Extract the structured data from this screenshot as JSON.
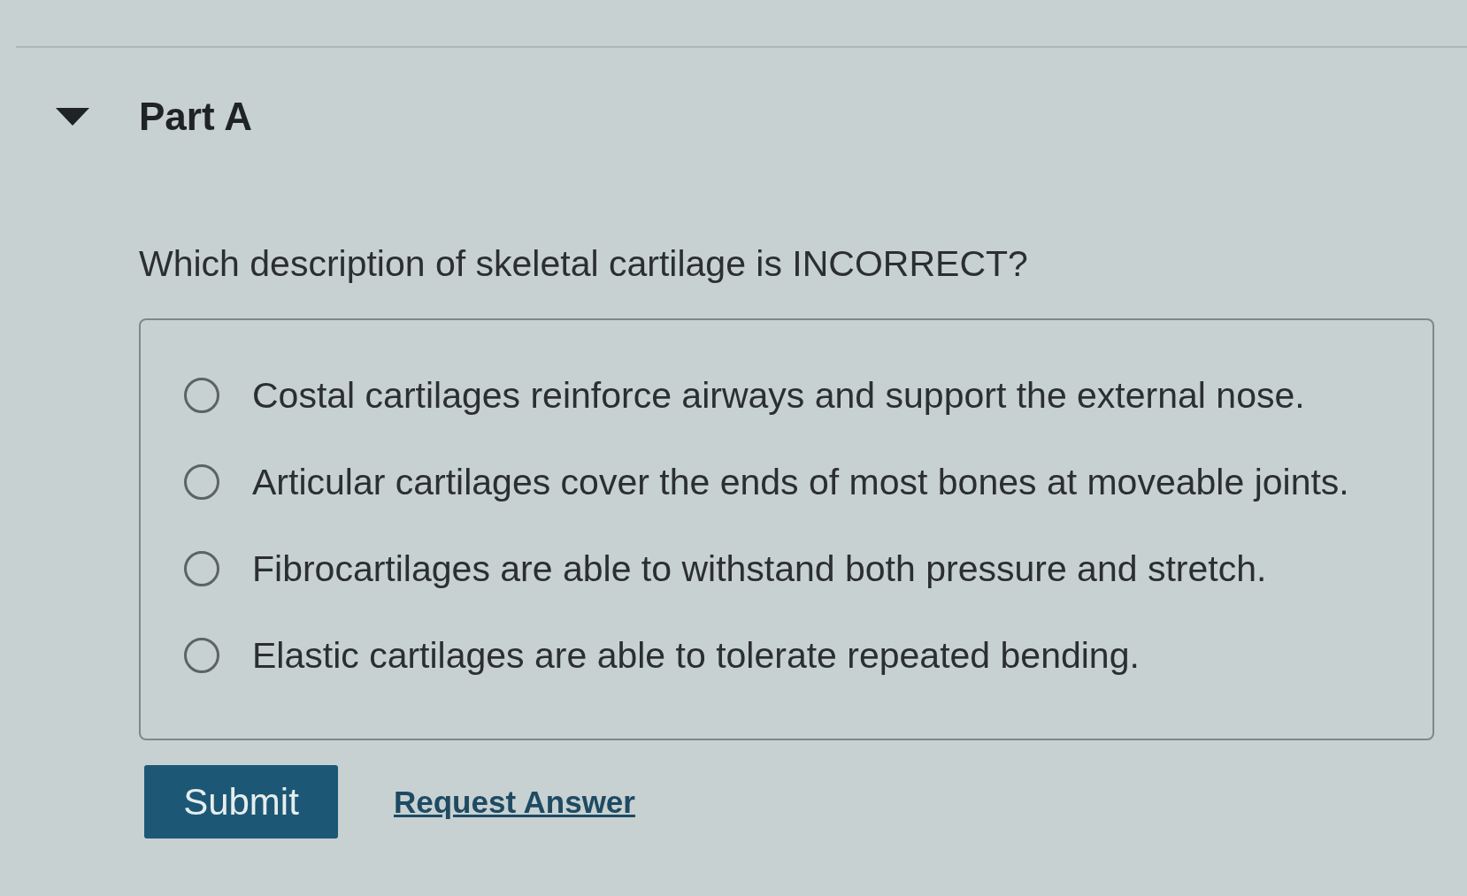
{
  "section": {
    "title": "Part A",
    "expanded": true
  },
  "question": "Which description of skeletal cartilage is INCORRECT?",
  "options": [
    {
      "label": "Costal cartilages reinforce airways and support the external nose.",
      "selected": false
    },
    {
      "label": "Articular cartilages cover the ends of most bones at moveable joints.",
      "selected": false
    },
    {
      "label": "Fibrocartilages are able to withstand both pressure and stretch.",
      "selected": false
    },
    {
      "label": "Elastic cartilages are able to tolerate repeated bending.",
      "selected": false
    }
  ],
  "actions": {
    "submit": "Submit",
    "request_answer": "Request Answer"
  }
}
